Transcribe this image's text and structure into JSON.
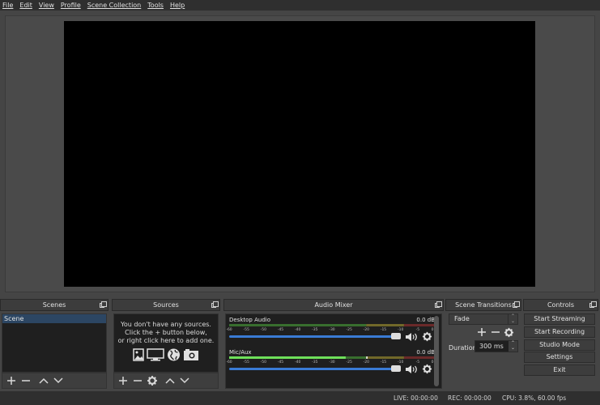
{
  "menubar": {
    "items": [
      "File",
      "Edit",
      "View",
      "Profile",
      "Scene Collection",
      "Tools",
      "Help"
    ]
  },
  "docks": {
    "scenes": {
      "title": "Scenes",
      "items": [
        "Scene"
      ],
      "selected": "Scene"
    },
    "sources": {
      "title": "Sources",
      "empty_message": [
        "You don't have any sources.",
        "Click the + button below,",
        "or right click here to add one."
      ]
    },
    "audio_mixer": {
      "title": "Audio Mixer",
      "ticks": [
        "-60",
        "-55",
        "-50",
        "-45",
        "-40",
        "-35",
        "-30",
        "-25",
        "-20",
        "-15",
        "-10",
        "-5",
        "0"
      ],
      "channels": [
        {
          "name": "Desktop Audio",
          "db": "0.0 dB",
          "level_db": -60,
          "volume_percent": 100
        },
        {
          "name": "Mic/Aux",
          "db": "0.0 dB",
          "level_db": -26,
          "peak_db": -20,
          "volume_percent": 100
        }
      ]
    },
    "scene_transitions": {
      "title": "Scene Transitions",
      "transition": "Fade",
      "duration_label": "Duration",
      "duration_value": "300 ms"
    },
    "controls": {
      "title": "Controls",
      "buttons": [
        "Start Streaming",
        "Start Recording",
        "Studio Mode",
        "Settings",
        "Exit"
      ]
    }
  },
  "status": {
    "live": "LIVE: 00:00:00",
    "rec": "REC: 00:00:00",
    "cpu": "CPU: 3.8%, 60.00 fps"
  },
  "colors": {
    "meter_green": "#4caf3a",
    "meter_yellow": "#b5a432",
    "meter_red": "#a83232",
    "volume_blue": "#3a7bd5",
    "selected_scene": "#2c4663"
  }
}
